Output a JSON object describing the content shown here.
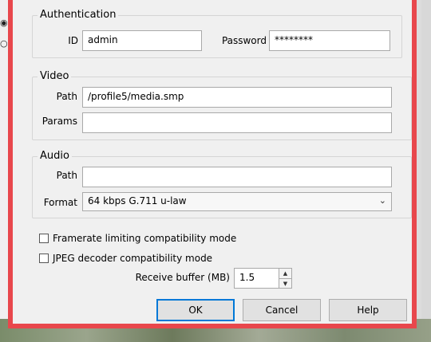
{
  "authentication": {
    "title": "Authentication",
    "id_label": "ID",
    "id_value": "admin",
    "password_label": "Password",
    "password_value": "********"
  },
  "video": {
    "title": "Video",
    "path_label": "Path",
    "path_value": "/profile5/media.smp",
    "params_label": "Params",
    "params_value": ""
  },
  "audio": {
    "title": "Audio",
    "path_label": "Path",
    "path_value": "",
    "format_label": "Format",
    "format_value": "64 kbps G.711 u-law"
  },
  "options": {
    "framerate_label": "Framerate limiting compatibility mode",
    "framerate_checked": false,
    "jpeg_label": "JPEG decoder compatibility mode",
    "jpeg_checked": false,
    "buffer_label": "Receive buffer (MB)",
    "buffer_value": "1.5"
  },
  "buttons": {
    "ok": "OK",
    "cancel": "Cancel",
    "help": "Help"
  },
  "colors": {
    "dialog_border": "#e8474c",
    "default_button_border": "#0078d7"
  },
  "icons": {
    "spinner_up": "up-arrow-icon",
    "spinner_down": "down-arrow-icon",
    "dropdown": "chevron-down-icon"
  }
}
